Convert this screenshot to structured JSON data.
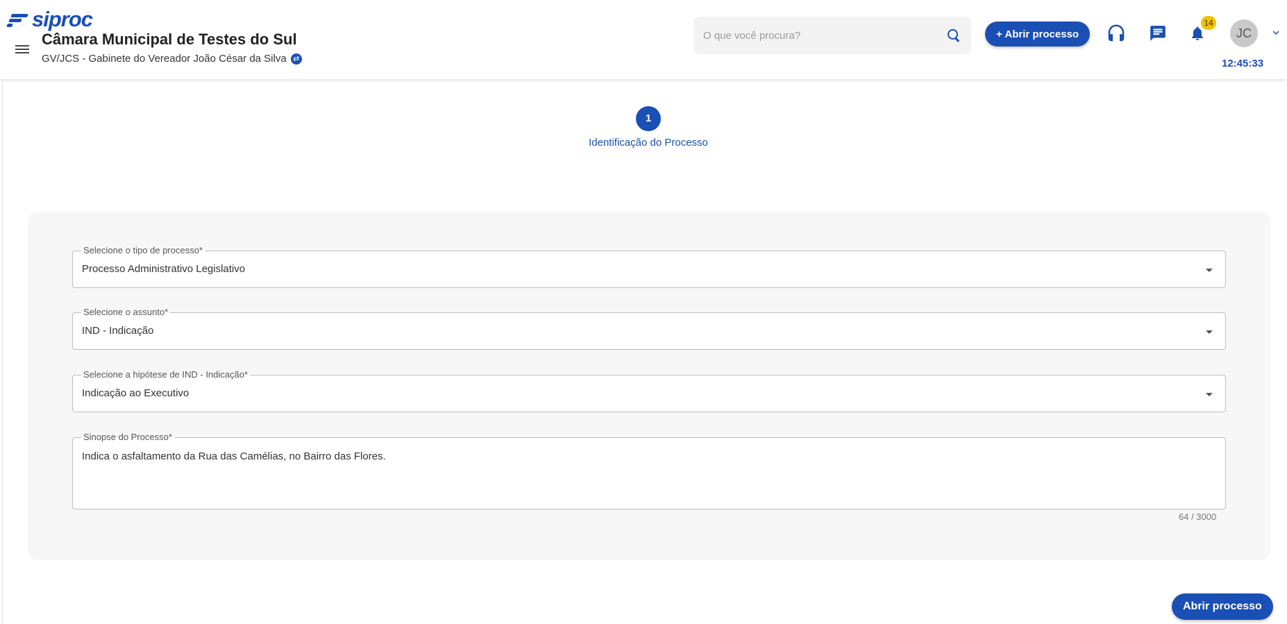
{
  "app": {
    "logo_text": "siproc"
  },
  "header": {
    "org_title": "Câmara Municipal de Testes do Sul",
    "org_subtitle": "GV/JCS - Gabinete do Vereador João César da Silva",
    "search_placeholder": "O que você procura?",
    "open_process_label": "+ Abrir processo",
    "notifications_count": "14",
    "avatar_initials": "JC",
    "clock": "12:45:33",
    "icons": [
      "menu-icon",
      "swap-icon",
      "search-icon",
      "headset-icon",
      "chat-icon",
      "bell-icon",
      "chevron-down-icon"
    ]
  },
  "stepper": {
    "step_number": "1",
    "step_label": "Identificação do Processo"
  },
  "form": {
    "tipo": {
      "label": "Selecione o tipo de processo*",
      "value": "Processo Administrativo Legislativo"
    },
    "assunto": {
      "label": "Selecione o assunto*",
      "value": "IND - Indicação"
    },
    "hipotese": {
      "label": "Selecione a hipótese de IND - Indicação*",
      "value": "Indicação ao Executivo"
    },
    "sinopse": {
      "label": "Sinopse do Processo*",
      "value": "Indica o asfaltamento da Rua das Camélias, no Bairro das Flores.",
      "counter": "64 / 3000"
    }
  },
  "footer": {
    "submit_label": "Abrir processo"
  },
  "colors": {
    "primary": "#1a4fb4",
    "badge": "#f2c200",
    "card_bg": "#f7f7f7"
  }
}
